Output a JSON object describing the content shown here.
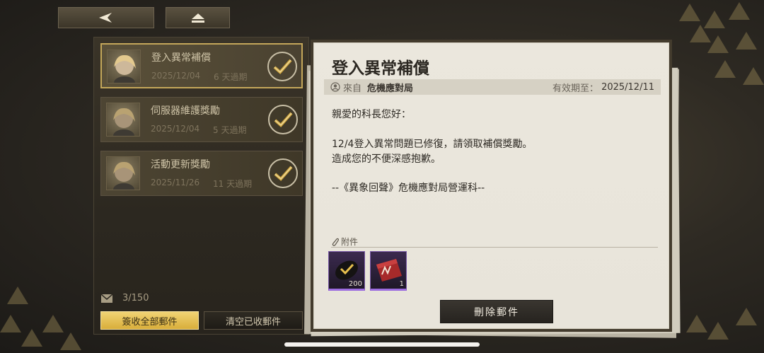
{
  "nav": {
    "back_icon": "back-arrow-icon",
    "home_icon": "eject-home-icon"
  },
  "mail_list": [
    {
      "title": "登入異常補償",
      "date": "2025/12/04",
      "expiry": "6 天過期",
      "selected": true
    },
    {
      "title": "伺服器維護獎勵",
      "date": "2025/12/04",
      "expiry": "5 天過期",
      "selected": false
    },
    {
      "title": "活動更新獎勵",
      "date": "2025/11/26",
      "expiry": "11 天過期",
      "selected": false
    }
  ],
  "footer": {
    "mail_count": "3/150",
    "claim_all_label": "簽收全部郵件",
    "clear_label": "清空已收郵件"
  },
  "letter": {
    "title": "登入異常補償",
    "from_label": "來自",
    "from_name": "危機應對局",
    "expiry_label": "有效期至：",
    "expiry_date": "2025/12/11",
    "greeting": "親愛的科長您好：",
    "line1": "12/4登入異常問題已修復，請領取補償獎勵。",
    "line2": "造成您的不便深感抱歉。",
    "signature": "--《異象回聲》危機應對局營運科--",
    "attachments_label": "附件",
    "attachments": [
      {
        "icon": "gold-coin-icon",
        "qty": "200"
      },
      {
        "icon": "red-ticket-box-icon",
        "qty": "1"
      }
    ],
    "delete_label": "刪除郵件"
  },
  "colors": {
    "accent_gold": "#d9ae3a",
    "rare_purple": "#9c6ce0",
    "paper": "#ebe7dd"
  }
}
